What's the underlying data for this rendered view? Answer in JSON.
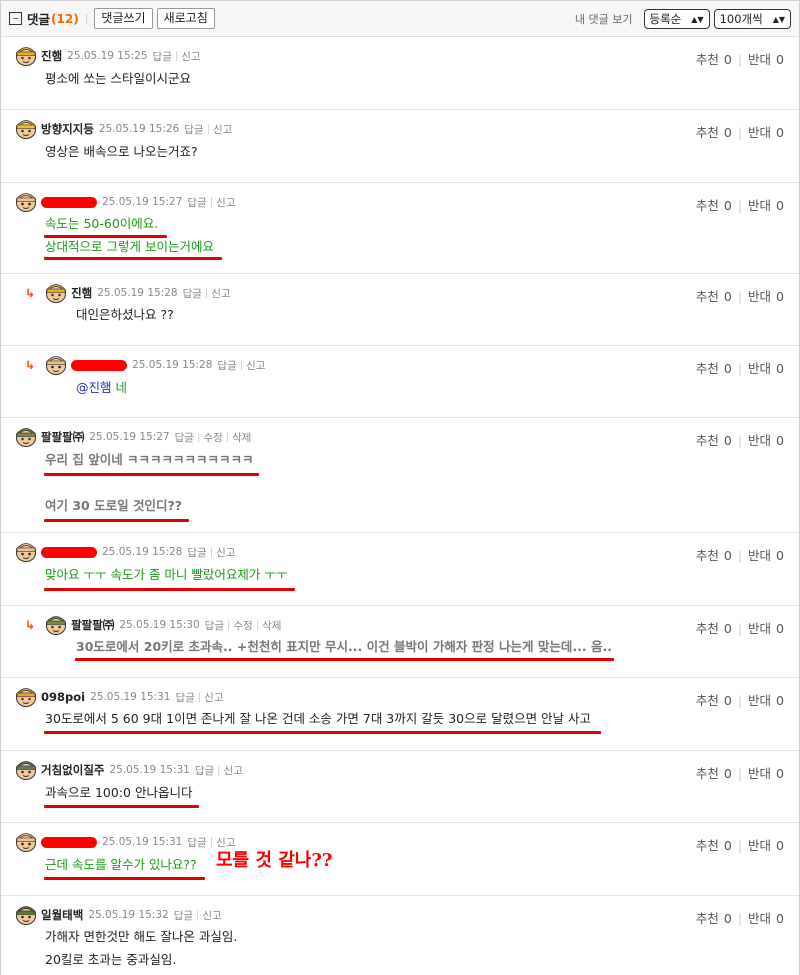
{
  "header": {
    "toggle_icon": "minus-box-icon",
    "title": "댓글",
    "count": "(12)",
    "write_button": "댓글쓰기",
    "refresh_button": "새로고침",
    "my_comments": "내 댓글 보기",
    "sort_select": "등록순",
    "page_size_select": "100개씩"
  },
  "labels": {
    "reply": "답글",
    "report": "신고",
    "edit": "수정",
    "delete": "삭제",
    "recommend": "추천",
    "oppose": "반대"
  },
  "comments": [
    {
      "nick": "진햄",
      "date": "25.05.19 15:25",
      "recommend": "0",
      "oppose": "0",
      "lines": [
        "평소에 쏘는 스타일이시군요"
      ]
    },
    {
      "nick": "방향지지등",
      "date": "25.05.19 15:26",
      "recommend": "0",
      "oppose": "0",
      "lines": [
        "영상은 배속으로 나오는거죠?"
      ]
    },
    {
      "nick": "",
      "date": "25.05.19 15:27",
      "recommend": "0",
      "oppose": "0",
      "lines": [
        "속도는 50-60이에요.",
        "상대적으로 그렇게 보이는거에요"
      ]
    },
    {
      "nick": "진햄",
      "date": "25.05.19 15:28",
      "recommend": "0",
      "oppose": "0",
      "lines": [
        "대인은하셨나요 ??"
      ]
    },
    {
      "nick": "",
      "date": "25.05.19 15:28",
      "recommend": "0",
      "oppose": "0",
      "mention": "@진햄",
      "lines": [
        "네"
      ]
    },
    {
      "nick": "팔팔팔㈜",
      "date": "25.05.19 15:27",
      "recommend": "0",
      "oppose": "0",
      "lines": [
        "우리 집 앞이네 ㅋㅋㅋㅋㅋㅋㅋㅋㅋㅋㅋ",
        "여기 30 도로일 것인디??"
      ]
    },
    {
      "nick": "",
      "date": "25.05.19 15:28",
      "recommend": "0",
      "oppose": "0",
      "lines": [
        "맞아요 ㅜㅜ 속도가 좀 마니 빨랐어요제가 ㅜㅜ"
      ]
    },
    {
      "nick": "팔팔팔㈜",
      "date": "25.05.19 15:30",
      "recommend": "0",
      "oppose": "0",
      "lines": [
        "30도로에서 20키로 초과속.. +천천히 표지만 무시... 이건 블박이 가해자 판정 나는게 맞는데... 음.."
      ]
    },
    {
      "nick": "098poi",
      "date": "25.05.19 15:31",
      "recommend": "0",
      "oppose": "0",
      "lines": [
        "30도로에서 5 60 9대 1이면 존나게 잘 나온 건데 소송 가면 7대 3까지 갈듯 30으로 달렸으면 안날 사고"
      ]
    },
    {
      "nick": "거침없이질주",
      "date": "25.05.19 15:31",
      "recommend": "0",
      "oppose": "0",
      "lines": [
        "과속으로 100:0 안나옵니다"
      ]
    },
    {
      "nick": "",
      "date": "25.05.19 15:31",
      "recommend": "0",
      "oppose": "0",
      "lines": [
        "근데 속도를 알수가 있나요??"
      ],
      "annotation": "모를 것 같나??"
    },
    {
      "nick": "일월태백",
      "date": "25.05.19 15:32",
      "recommend": "0",
      "oppose": "0",
      "lines": [
        "가해자 면한것만 해도 잘나온 과실임.",
        "20킬로 초과는 중과실임."
      ]
    }
  ]
}
